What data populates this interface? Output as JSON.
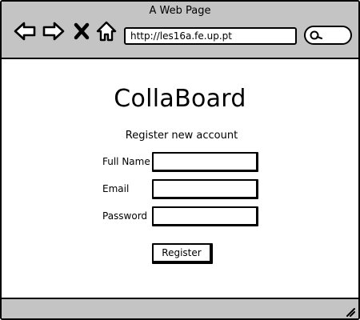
{
  "window": {
    "title": "A Web Page"
  },
  "toolbar": {
    "back_icon": "back-arrow-icon",
    "forward_icon": "forward-arrow-icon",
    "stop_icon": "close-icon",
    "home_icon": "home-icon",
    "url": "http://les16a.fe.up.pt",
    "search_icon": "search-icon"
  },
  "page": {
    "app_title": "CollaBoard",
    "subtitle": "Register new account",
    "form": {
      "full_name_label": "Full Name",
      "full_name_value": "",
      "email_label": "Email",
      "email_value": "",
      "password_label": "Password",
      "password_value": "",
      "submit_label": "Register"
    }
  },
  "statusbar": {
    "resize_icon": "resize-grip-icon"
  },
  "colors": {
    "chrome": "#c4c4c4",
    "background": "#ffffff",
    "stroke": "#000000"
  }
}
